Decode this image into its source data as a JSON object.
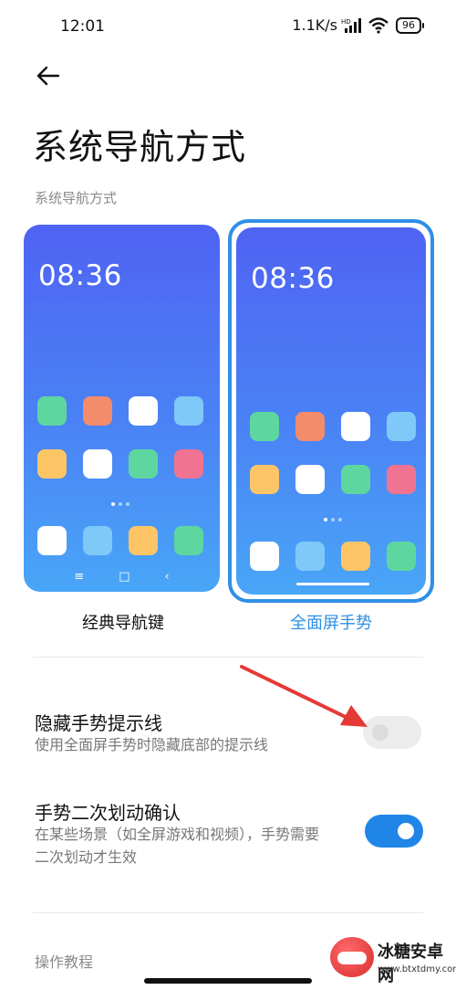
{
  "status_bar": {
    "time": "12:01",
    "net_speed": "1.1K/s",
    "battery": "96",
    "icons": [
      "hd-signal-icon",
      "wifi-icon",
      "battery-icon"
    ]
  },
  "header": {
    "back_icon": "arrow-left-icon",
    "title": "系统导航方式"
  },
  "navigation_mode": {
    "section_label": "系统导航方式",
    "options": [
      {
        "label": "经典导航键",
        "selected": false,
        "preview_time": "08:36",
        "app_colors": [
          "#5ed6a0",
          "#f28c6a",
          "#ffffff",
          "#7ec9f8",
          "#fdc566",
          "#ffffff",
          "#5ed6a0",
          "#f07391"
        ],
        "dock_colors": [
          "#ffffff",
          "#7ec9f8",
          "#fdc566",
          "#5ed6a0"
        ],
        "nav_keys": [
          "≡",
          "□",
          "‹"
        ]
      },
      {
        "label": "全面屏手势",
        "selected": true,
        "preview_time": "08:36",
        "app_colors": [
          "#5ed6a0",
          "#f28c6a",
          "#ffffff",
          "#7ec9f8",
          "#fdc566",
          "#ffffff",
          "#5ed6a0",
          "#f07391"
        ],
        "dock_colors": [
          "#ffffff",
          "#7ec9f8",
          "#fdc566",
          "#5ed6a0"
        ]
      }
    ],
    "accent_color": "#2f8fe6"
  },
  "settings": [
    {
      "title": "隐藏手势提示线",
      "description": "使用全面屏手势时隐藏底部的提示线",
      "enabled": false
    },
    {
      "title": "手势二次划动确认",
      "description_line1": "在某些场景（如全屏游戏和视频），手势需要",
      "description_line2": "二次划动才生效",
      "enabled": true
    }
  ],
  "footer": {
    "section_label": "操作教程"
  },
  "annotation": {
    "arrow_color": "#e53935"
  },
  "watermark": {
    "name": "冰糖安卓网",
    "url": "www.btxtdmy.com"
  }
}
